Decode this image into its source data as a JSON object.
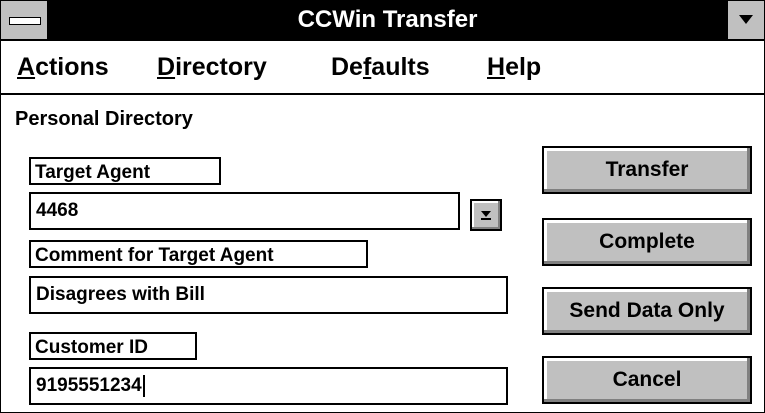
{
  "window": {
    "title": "CCWin Transfer"
  },
  "menu": [
    {
      "accel": "A",
      "rest": "ctions"
    },
    {
      "accel": "D",
      "rest": "irectory"
    },
    {
      "pre": "De",
      "accel": "f",
      "rest": "aults"
    },
    {
      "accel": "H",
      "rest": "elp"
    }
  ],
  "form": {
    "section_title": "Personal Directory",
    "target_agent_label": "Target Agent",
    "target_agent_value": "4468",
    "comment_label": "Comment for Target Agent",
    "comment_value": "Disagrees with Bill",
    "customer_id_label": "Customer ID",
    "customer_id_value": "9195551234"
  },
  "buttons": {
    "transfer": "Transfer",
    "complete": "Complete",
    "send_data_only": "Send Data Only",
    "cancel": "Cancel"
  },
  "icons": {
    "system_menu": "system-menu-icon",
    "minimize": "minimize-icon",
    "dropdown": "dropdown-arrow-icon"
  }
}
